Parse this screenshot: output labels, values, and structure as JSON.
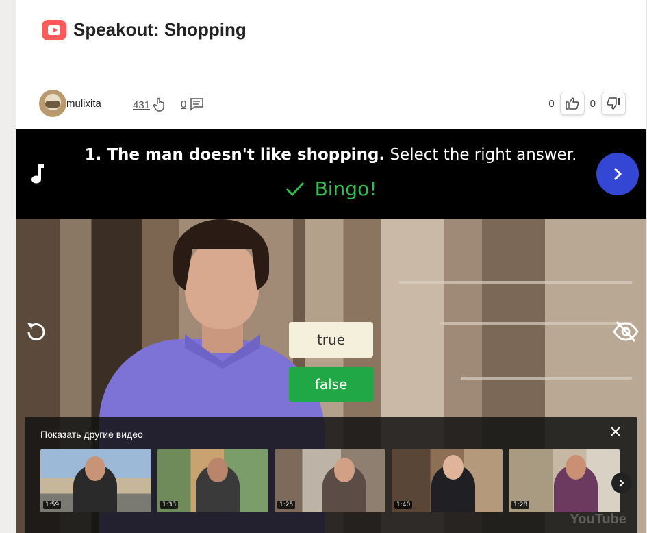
{
  "header": {
    "title": "Speakout: Shopping"
  },
  "meta": {
    "username": "mulixita",
    "views": "431",
    "comments": "0",
    "likes": "0",
    "dislikes": "0"
  },
  "question": {
    "prompt_bold": "1. The man doesn't like shopping.",
    "prompt_rest": "Select the right answer.",
    "feedback": "Bingo!"
  },
  "answers": {
    "true_label": "true",
    "false_label": "false"
  },
  "more_videos": {
    "title": "Показать другие видео",
    "durations": [
      "1:59",
      "1:33",
      "1:25",
      "1:40",
      "1:28"
    ]
  },
  "player": {
    "watermark": "YouTube"
  },
  "colors": {
    "accent_blue": "#3447d4",
    "success_green": "#2fbf4f",
    "logo_red": "#ff5a5a"
  }
}
